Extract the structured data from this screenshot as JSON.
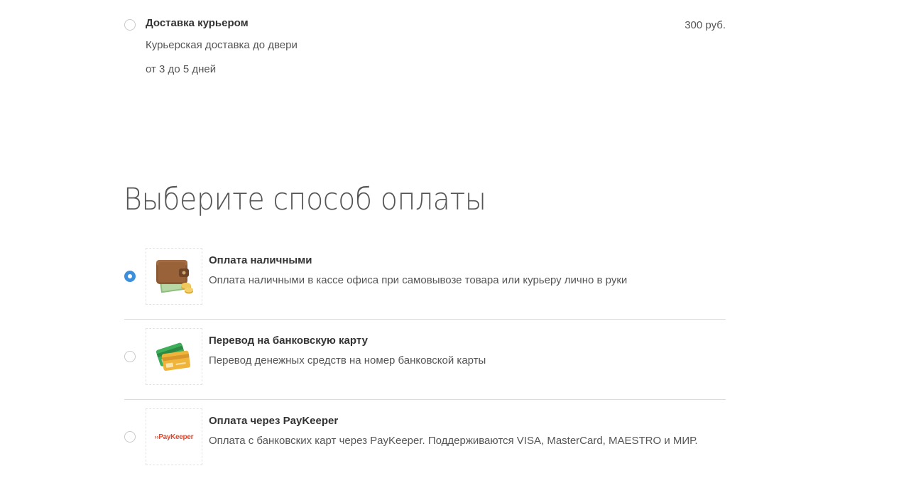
{
  "delivery": {
    "title": "Доставка курьером",
    "description": "Курьерская доставка до двери",
    "term": "от 3 до 5 дней",
    "price": "300 руб.",
    "selected": false
  },
  "payment_section": {
    "heading": "Выберите способ оплаты",
    "options": [
      {
        "title": "Оплата наличными",
        "description": "Оплата наличными в кассе офиса при самовывозе товара или курьеру лично в руки",
        "icon": "wallet-icon",
        "selected": true
      },
      {
        "title": "Перевод на банковскую карту",
        "description": "Перевод денежных средств на номер банковской карты",
        "icon": "bank-cards-icon",
        "selected": false
      },
      {
        "title": "Оплата через PayKeeper",
        "description": "Оплата с банковских карт через PayKeeper. Поддерживаются VISA, MasterCard, MAESTRO и МИР.",
        "icon": "paykeeper-logo",
        "logo_text": "PayKeeper",
        "selected": false
      }
    ]
  },
  "colors": {
    "radio_selected": "#3d8fdc",
    "paykeeper_brand": "#e2492f"
  }
}
